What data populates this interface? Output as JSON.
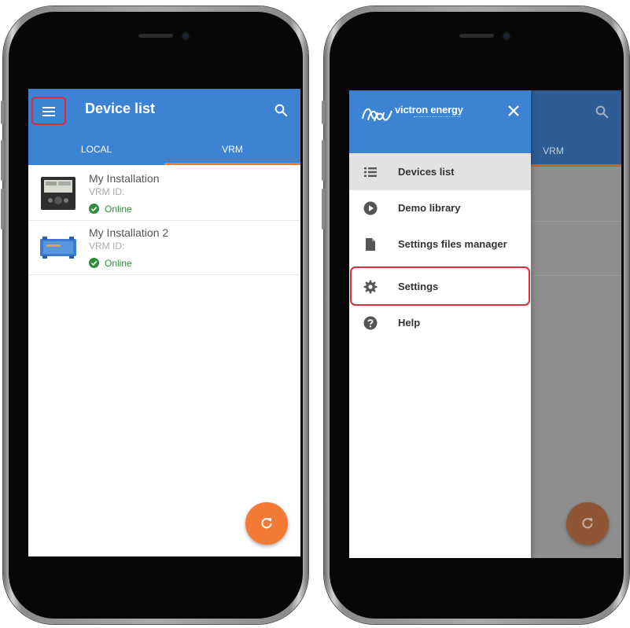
{
  "left_screen": {
    "title": "Device list",
    "tabs": [
      {
        "label": "LOCAL",
        "active": false
      },
      {
        "label": "VRM",
        "active": true
      }
    ],
    "devices": [
      {
        "name": "My Installation",
        "vrm_label": "VRM ID:",
        "status": "Online"
      },
      {
        "name": "My Installation 2",
        "vrm_label": "VRM ID:",
        "status": "Online"
      }
    ],
    "icons": {
      "menu": "menu-icon",
      "search": "search-icon",
      "refresh": "refresh-icon",
      "status": "check-circle-icon"
    }
  },
  "right_screen": {
    "brand": {
      "name": "victron energy",
      "logo": "victron-logo"
    },
    "background_tab": "VRM",
    "drawer_items": [
      {
        "label": "Devices list",
        "icon": "list-icon",
        "active": true
      },
      {
        "label": "Demo library",
        "icon": "play-circle-icon",
        "active": false
      },
      {
        "label": "Settings files manager",
        "icon": "file-icon",
        "active": false
      },
      {
        "label": "Settings",
        "icon": "gear-icon",
        "active": false,
        "highlighted": true
      },
      {
        "label": "Help",
        "icon": "help-circle-icon",
        "active": false
      }
    ]
  },
  "colors": {
    "appbar_blue": "#3d83d3",
    "accent_orange": "#f37a35",
    "highlight_red": "#e02a3a",
    "online_green": "#2e8b3a"
  }
}
